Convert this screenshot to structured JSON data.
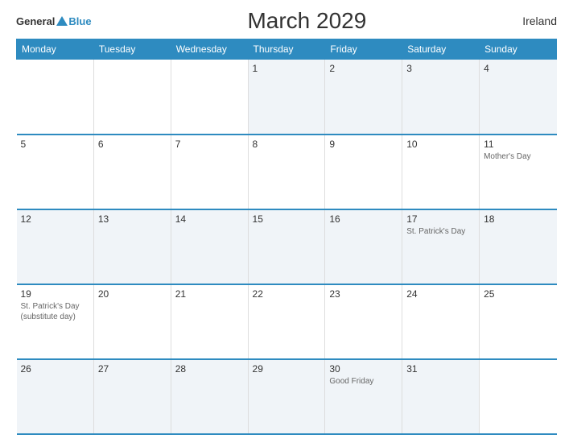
{
  "header": {
    "title": "March 2029",
    "country": "Ireland",
    "logo_general": "General",
    "logo_blue": "Blue"
  },
  "weekdays": [
    "Monday",
    "Tuesday",
    "Wednesday",
    "Thursday",
    "Friday",
    "Saturday",
    "Sunday"
  ],
  "weeks": [
    [
      {
        "day": "",
        "holiday": "",
        "empty": true
      },
      {
        "day": "",
        "holiday": "",
        "empty": true
      },
      {
        "day": "",
        "holiday": "",
        "empty": true
      },
      {
        "day": "1",
        "holiday": ""
      },
      {
        "day": "2",
        "holiday": ""
      },
      {
        "day": "3",
        "holiday": ""
      },
      {
        "day": "4",
        "holiday": ""
      }
    ],
    [
      {
        "day": "5",
        "holiday": ""
      },
      {
        "day": "6",
        "holiday": ""
      },
      {
        "day": "7",
        "holiday": ""
      },
      {
        "day": "8",
        "holiday": ""
      },
      {
        "day": "9",
        "holiday": ""
      },
      {
        "day": "10",
        "holiday": ""
      },
      {
        "day": "11",
        "holiday": "Mother's Day"
      }
    ],
    [
      {
        "day": "12",
        "holiday": ""
      },
      {
        "day": "13",
        "holiday": ""
      },
      {
        "day": "14",
        "holiday": ""
      },
      {
        "day": "15",
        "holiday": ""
      },
      {
        "day": "16",
        "holiday": ""
      },
      {
        "day": "17",
        "holiday": "St. Patrick's Day"
      },
      {
        "day": "18",
        "holiday": ""
      }
    ],
    [
      {
        "day": "19",
        "holiday": "St. Patrick's Day\n(substitute day)"
      },
      {
        "day": "20",
        "holiday": ""
      },
      {
        "day": "21",
        "holiday": ""
      },
      {
        "day": "22",
        "holiday": ""
      },
      {
        "day": "23",
        "holiday": ""
      },
      {
        "day": "24",
        "holiday": ""
      },
      {
        "day": "25",
        "holiday": ""
      }
    ],
    [
      {
        "day": "26",
        "holiday": ""
      },
      {
        "day": "27",
        "holiday": ""
      },
      {
        "day": "28",
        "holiday": ""
      },
      {
        "day": "29",
        "holiday": ""
      },
      {
        "day": "30",
        "holiday": "Good Friday"
      },
      {
        "day": "31",
        "holiday": ""
      },
      {
        "day": "",
        "holiday": "",
        "empty": true
      }
    ]
  ]
}
